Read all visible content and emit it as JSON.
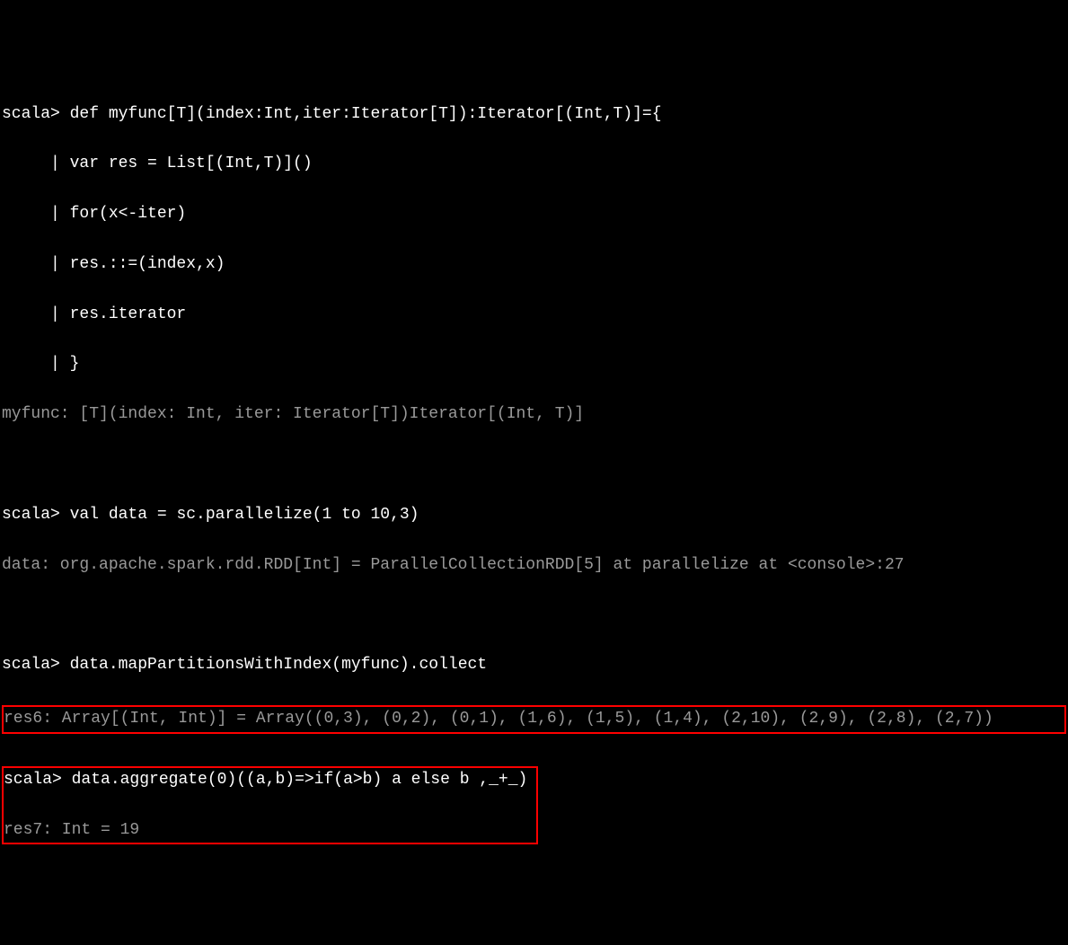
{
  "l1_prompt": "scala> ",
  "l1_code": "def myfunc[T](index:Int,iter:Iterator[T]):Iterator[(Int,T)]={",
  "l2": "     | var res = List[(Int,T)]()",
  "l3": "     | for(x<-iter)",
  "l4": "     | res.::=(index,x)",
  "l5": "     | res.iterator",
  "l6": "     | }",
  "l7": "myfunc: [T](index: Int, iter: Iterator[T])Iterator[(Int, T)]",
  "l8_prompt": "scala> ",
  "l8_code": "val data = sc.parallelize(1 to 10,3)",
  "l9": "data: org.apache.spark.rdd.RDD[Int] = ParallelCollectionRDD[5] at parallelize at <console>:27",
  "l10_prompt": "scala> ",
  "l10_code": "data.mapPartitionsWithIndex(myfunc).collect",
  "box1_line1": "res6: Array[(Int, Int)] = Array((0,3), (0,2), (0,1), (1,6), (1,5), (1,4), (2,10), (2,9), (2,8), (2,7))",
  "box2_line1_prompt": "scala> ",
  "box2_line1_code": "data.aggregate(0)((a,b)=>if(a>b) a else b ,_+_)",
  "box2_line2": "res7: Int = 19"
}
